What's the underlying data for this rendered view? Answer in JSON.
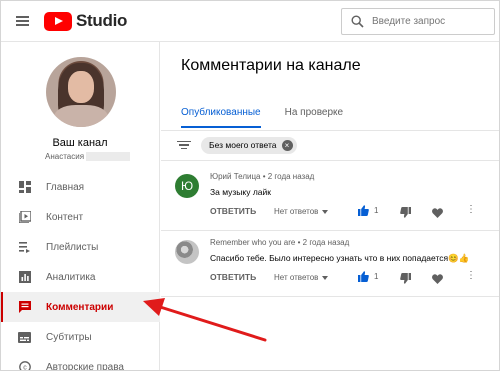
{
  "app": {
    "logo_text": "Studio",
    "brand_color": "#ff0000",
    "accent_color": "#065fd4",
    "active_color": "#cc0000"
  },
  "search": {
    "placeholder": "Введите запрос"
  },
  "channel": {
    "name": "Ваш канал",
    "owner": "Анастасия"
  },
  "sidebar": {
    "items": [
      {
        "label": "Главная",
        "icon": "dashboard-icon"
      },
      {
        "label": "Контент",
        "icon": "video-library-icon"
      },
      {
        "label": "Плейлисты",
        "icon": "playlist-icon"
      },
      {
        "label": "Аналитика",
        "icon": "analytics-icon"
      },
      {
        "label": "Комментарии",
        "icon": "comment-icon",
        "active": true
      },
      {
        "label": "Субтитры",
        "icon": "subtitles-icon"
      },
      {
        "label": "Авторские права",
        "icon": "copyright-icon"
      }
    ]
  },
  "main": {
    "title": "Комментарии на канале",
    "tabs": [
      {
        "label": "Опубликованные",
        "active": true
      },
      {
        "label": "На проверке",
        "active": false
      }
    ],
    "filter_chip": "Без моего ответа"
  },
  "comments": [
    {
      "avatar_letter": "Ю",
      "author": "Юрий Телица",
      "time": "2 года назад",
      "text": "За музыку лайк",
      "reply_label": "ОТВЕТИТЬ",
      "replies_label": "Нет ответов",
      "likes": "1"
    },
    {
      "avatar_letter": "",
      "author": "Remember who you are",
      "time": "2 года назад",
      "text": "Спасибо тебе. Было интересно узнать что в них попадается😊👍",
      "reply_label": "ОТВЕТИТЬ",
      "replies_label": "Нет ответов",
      "likes": "1"
    }
  ]
}
